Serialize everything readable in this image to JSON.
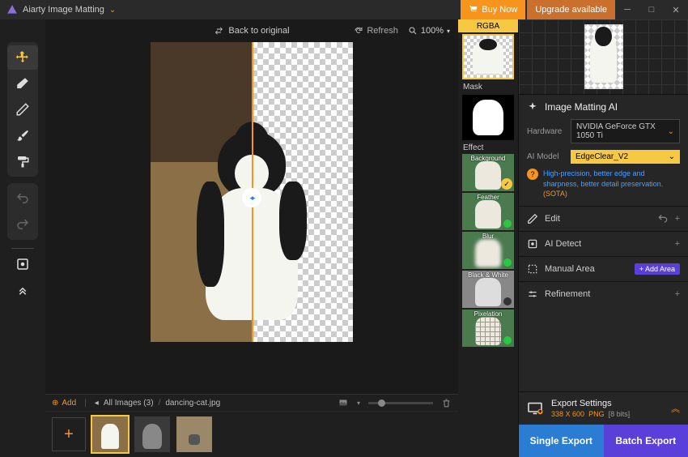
{
  "titlebar": {
    "app_name": "Aiarty Image Matting",
    "buy_label": "Buy Now",
    "upgrade_label": "Upgrade available"
  },
  "canvas": {
    "back_label": "Back to original",
    "refresh_label": "Refresh",
    "zoom_value": "100%"
  },
  "previews": {
    "rgba_label": "RGBA",
    "mask_label": "Mask",
    "effect_label": "Effect"
  },
  "effects": [
    {
      "name": "Background",
      "selected": true
    },
    {
      "name": "Feather",
      "indicator": "green"
    },
    {
      "name": "Blur",
      "indicator": "green"
    },
    {
      "name": "Black & White",
      "indicator": "dark"
    },
    {
      "name": "Pixelation",
      "indicator": "green"
    }
  ],
  "right": {
    "matting_title": "Image Matting AI",
    "hardware_label": "Hardware",
    "hardware_value": "NVIDIA GeForce GTX 1050 Ti",
    "model_label": "AI Model",
    "model_value": "EdgeClear_V2",
    "model_info": "High-precision, better edge and sharpness, better detail preservation.",
    "model_sota": "(SOTA)",
    "edit_label": "Edit",
    "detect_label": "AI Detect",
    "manual_label": "Manual Area",
    "add_area_label": "Add Area",
    "refinement_label": "Refinement"
  },
  "export": {
    "settings_title": "Export Settings",
    "dimensions": "338 X 600",
    "format": "PNG",
    "bits": "[8 bits]",
    "single_label": "Single Export",
    "batch_label": "Batch Export"
  },
  "bottom": {
    "add_label": "Add",
    "all_images_label": "All Images",
    "image_count": "(3)",
    "current_file": "dancing-cat.jpg"
  }
}
